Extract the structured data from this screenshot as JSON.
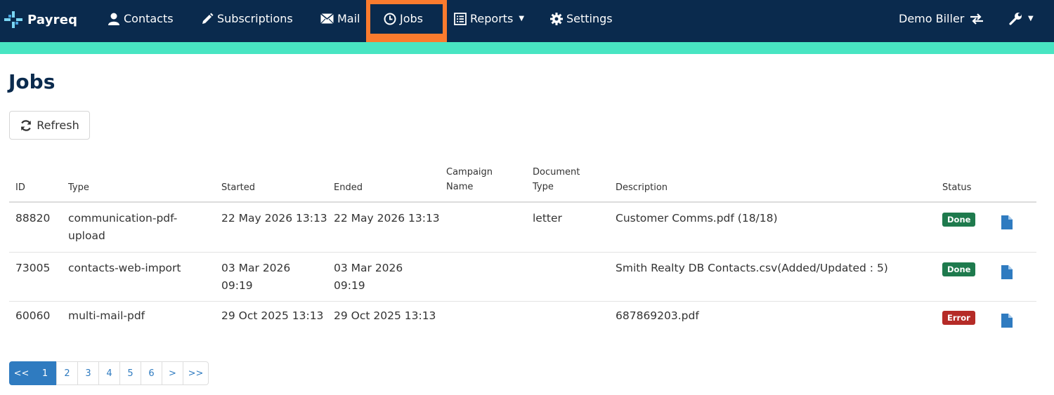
{
  "brand": {
    "name": "Payreq"
  },
  "nav": {
    "contacts": "Contacts",
    "subscriptions": "Subscriptions",
    "mail": "Mail",
    "jobs": "Jobs",
    "reports": "Reports",
    "settings": "Settings",
    "account": "Demo Biller"
  },
  "colors": {
    "navbar": "#0a2a4d",
    "accent": "#48e5c2",
    "highlight": "#fa7b2e",
    "done": "#1e7a4d",
    "error": "#b52b27",
    "link": "#2f7bc0"
  },
  "page": {
    "title": "Jobs",
    "refresh_label": "Refresh"
  },
  "table": {
    "headers": {
      "id": "ID",
      "type": "Type",
      "started": "Started",
      "ended": "Ended",
      "campaign_1": "Campaign",
      "campaign_2": "Name",
      "doctype_1": "Document",
      "doctype_2": "Type",
      "description": "Description",
      "status": "Status"
    },
    "rows": [
      {
        "id": "88820",
        "type_1": "communication-pdf-",
        "type_2": "upload",
        "started_1": "22 May 2026 13:13",
        "started_2": "",
        "ended_1": "22 May 2026 13:13",
        "ended_2": "",
        "campaign": "",
        "doctype": "letter",
        "description": "Customer Comms.pdf (18/18)",
        "status": "Done"
      },
      {
        "id": "73005",
        "type_1": "contacts-web-import",
        "type_2": "",
        "started_1": "03 Mar 2026",
        "started_2": "09:19",
        "ended_1": "03 Mar 2026",
        "ended_2": "09:19",
        "campaign": "",
        "doctype": "",
        "description": "Smith Realty DB Contacts.csv(Added/Updated : 5)",
        "status": "Done"
      },
      {
        "id": "60060",
        "type_1": "multi-mail-pdf",
        "type_2": "",
        "started_1": "29 Oct 2025 13:13",
        "started_2": "",
        "ended_1": "29 Oct 2025 13:13",
        "ended_2": "",
        "campaign": "",
        "doctype": "",
        "description": "687869203.pdf",
        "status": "Error"
      }
    ]
  },
  "pagination": {
    "first": "<<",
    "pages": [
      "1",
      "2",
      "3",
      "4",
      "5",
      "6"
    ],
    "next": ">",
    "last": ">>",
    "active": "1"
  },
  "icons": [
    "payreq-logo",
    "user-icon",
    "pencil-icon",
    "envelope-icon",
    "clock-icon",
    "list-icon",
    "gear-icon",
    "swap-icon",
    "wrench-icon",
    "refresh-icon",
    "file-icon"
  ]
}
